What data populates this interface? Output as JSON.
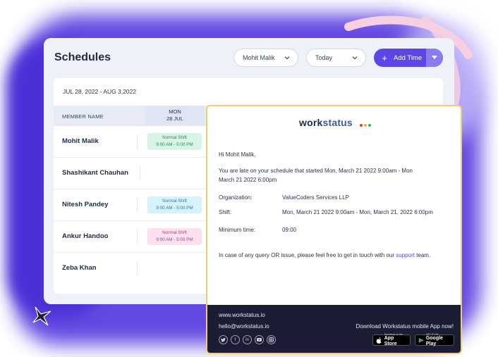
{
  "schedules": {
    "title": "Schedules",
    "member_filter": "Mohit Malik",
    "date_filter": "Today",
    "add_time_label": "Add Time",
    "date_range": "JUL 28, 2022 - AUG 3,2022",
    "columns": {
      "member": "MEMBER NAME",
      "day_name": "MON",
      "day_date": "28 JUL"
    },
    "rows": [
      {
        "name": "Mohit Malik",
        "shift_title": "Normal Shift",
        "shift_time": "9:00 AM - 5:00 PM",
        "color": "#d7f5e4"
      },
      {
        "name": "Shashikant Chauhan",
        "shift_title": "",
        "shift_time": ""
      },
      {
        "name": "Nitesh Pandey",
        "shift_title": "Normal Shift",
        "shift_time": "9:00 AM - 5:00 PM",
        "color": "#d6f2fa"
      },
      {
        "name": "Ankur Handoo",
        "shift_title": "Normal Shift",
        "shift_time": "9:00 AM - 5:00 PM",
        "color": "#fbe0ef"
      },
      {
        "name": "Zeba Khan",
        "shift_title": "",
        "shift_time": ""
      }
    ]
  },
  "email": {
    "logo_work": "work",
    "logo_status": "status",
    "logo_dots": [
      "#e03a3a",
      "#f2b01e",
      "#2bb673"
    ],
    "greeting": "Hi Mohit Malik,",
    "message_line1": "You are late on your schedule that started Mon, March 21 2022 9:00am - Mon",
    "message_line2": "March 21 2022 6:00pm",
    "org_label": "Organization:",
    "org_value": "ValueCoders Services LLP",
    "shift_label": "Shift:",
    "shift_value": "Mon, March 21 2022 9:00am - Mon, March 21, 2022 6:00pm",
    "min_time_label": "Minimum time:",
    "min_time_value": "09:00",
    "query_text": "In case of any query OR issue, please feel free to get in touch with our",
    "support_link": "support",
    "query_end": "team.",
    "footer": {
      "website": "www.workstatus.io",
      "email": "hello@workstatus.io",
      "download_text": "Download Workstatus mobile App now!",
      "socials": [
        "twitter-icon",
        "facebook-icon",
        "linkedin-icon",
        "youtube-icon",
        "instagram-icon"
      ],
      "app_store_small": "Download on the",
      "app_store": "App Store",
      "google_play_small": "GET IT ON",
      "google_play": "Google Play"
    }
  },
  "colors": {
    "accent": "#5a47e6",
    "background_blob": "#5b3fe0",
    "email_border": "#f2cd6d",
    "footer_bg": "#1a1d33"
  }
}
